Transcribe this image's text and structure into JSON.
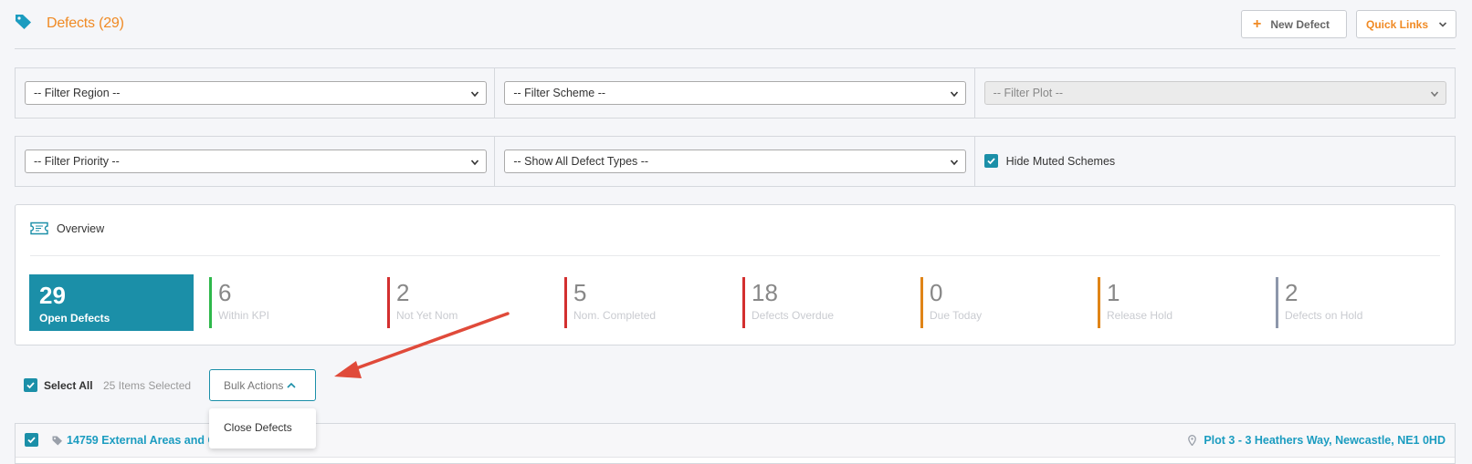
{
  "header": {
    "title": "Defects (29)",
    "new_defect_label": "New Defect",
    "quick_links_label": "Quick Links"
  },
  "filters": {
    "region": "-- Filter Region --",
    "scheme": "-- Filter Scheme --",
    "plot": "-- Filter Plot --",
    "priority": "-- Filter Priority --",
    "defect_types": "-- Show All Defect Types --",
    "hide_muted_label": "Hide Muted Schemes",
    "hide_muted_checked": true
  },
  "overview": {
    "title": "Overview",
    "main": {
      "value": "29",
      "label": "Open Defects"
    },
    "kpis": [
      {
        "value": "6",
        "label": "Within KPI",
        "color": "#2eb84b"
      },
      {
        "value": "2",
        "label": "Not Yet Nom",
        "color": "#d32f2f"
      },
      {
        "value": "5",
        "label": "Nom. Completed",
        "color": "#d32f2f"
      },
      {
        "value": "18",
        "label": "Defects Overdue",
        "color": "#d32f2f"
      },
      {
        "value": "0",
        "label": "Due Today",
        "color": "#e08417"
      },
      {
        "value": "1",
        "label": "Release Hold",
        "color": "#e08417"
      },
      {
        "value": "2",
        "label": "Defects on Hold",
        "color": "#8d97ab"
      }
    ]
  },
  "selection": {
    "select_all_label": "Select All",
    "count_label": "25 Items Selected",
    "bulk_actions_label": "Bulk Actions",
    "dropdown_items": [
      "Close Defects"
    ]
  },
  "rows": [
    {
      "title": "14759 External Areas and C",
      "location": "Plot 3 - 3 Heathers Way, Newcastle, NE1 0HD"
    }
  ],
  "colors": {
    "accent": "#f08a24",
    "teal": "#1b8fa8",
    "annotation": "#e04a3a"
  }
}
